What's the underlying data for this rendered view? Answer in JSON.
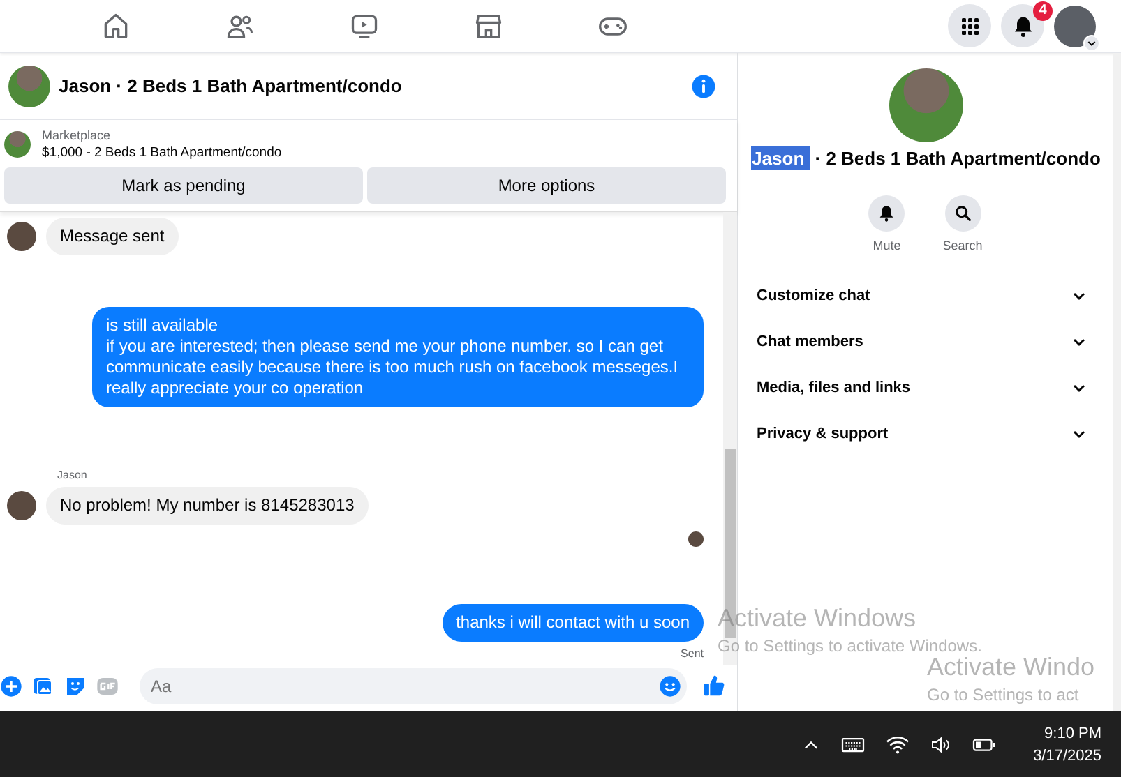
{
  "nav": {
    "notification_count": "4"
  },
  "chat_header": {
    "title": "Jason · 2 Beds 1 Bath Apartment/condo"
  },
  "listing": {
    "label": "Marketplace",
    "text": "$1,000 - 2 Beds 1 Bath Apartment/condo",
    "buttons": [
      "Mark as pending",
      "More options"
    ]
  },
  "messages": [
    {
      "kind": "incoming",
      "text": "Message sent"
    },
    {
      "kind": "outgoing",
      "text": "is still available\nif you are interested; then please send me your phone number. so I can get communicate easily because there is too much rush on facebook messeges.I really appreciate your co operation"
    },
    {
      "kind": "incoming",
      "sender": "Jason",
      "text": "No problem! My number is 8145283013"
    },
    {
      "kind": "seen"
    },
    {
      "kind": "outgoing",
      "text": "thanks i will contact with u soon",
      "status": "Sent"
    }
  ],
  "composer": {
    "placeholder": "Aa"
  },
  "details": {
    "name": "Jason",
    "name_highlighted": true,
    "title_rest": " · 2 Beds 1 Bath Apartment/condo",
    "actions": [
      {
        "kind": "mute",
        "label": "Mute"
      },
      {
        "kind": "search",
        "label": "Search"
      }
    ],
    "sections": [
      {
        "label": "Customize chat",
        "expanded": false
      },
      {
        "label": "Chat members",
        "expanded": false
      },
      {
        "label": "Media, files and links",
        "expanded": false
      },
      {
        "label": "Privacy & support",
        "expanded": false
      }
    ]
  },
  "overlay": [
    {
      "title": "Activate Windows",
      "text": "Go to Settings to activate Windows."
    },
    {
      "title": "Activate Windo",
      "text": "Go to Settings to act"
    }
  ],
  "taskbar": {
    "time": "9:10 PM",
    "date": "3/17/2025"
  }
}
